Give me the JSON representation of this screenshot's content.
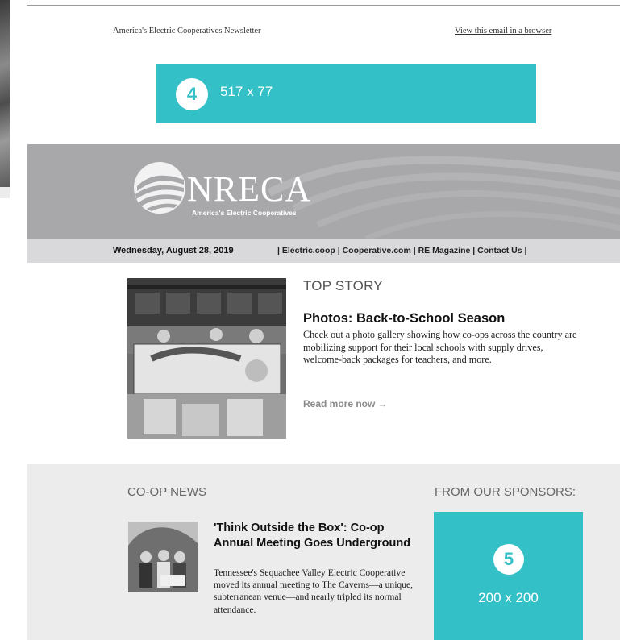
{
  "preheader": {
    "newsletter_name": "America's Electric Cooperatives Newsletter",
    "view_in_browser": "View this email in a browser"
  },
  "ads": {
    "top": {
      "number": "4",
      "size": "517 x 77"
    },
    "side": {
      "number": "5",
      "size": "200 x 200"
    }
  },
  "banner": {
    "logo_text": "NRECA",
    "tagline": "America's Electric Cooperatives"
  },
  "datebar": {
    "date": "Wednesday, August 28, 2019",
    "links": [
      "Electric.coop",
      "Cooperative.com",
      "RE Magazine",
      "Contact Us"
    ]
  },
  "top_story": {
    "section_label": "TOP STORY",
    "title": "Photos: Back-to-School Season",
    "body": "Check out a photo gallery showing how co-ops across the country are mobilizing support for their local schools with supply drives, welcome-back packages for teachers, and more.",
    "read_more": "Read more now →"
  },
  "coop_news": {
    "section_label": "CO-OP NEWS",
    "title": "'Think Outside the Box': Co-op Annual Meeting Goes Underground",
    "body": "Tennessee's Sequachee Valley Electric Cooperative moved its annual meeting to The Caverns—a unique, subterranean venue—and nearly tripled its normal attendance."
  },
  "sponsors": {
    "section_label": "FROM OUR SPONSORS:"
  },
  "colors": {
    "ad_teal": "#33c0c6",
    "banner_gray": "#a8a8ab",
    "datebar_gray": "#d9d9db",
    "lower_bg": "#ececec"
  }
}
